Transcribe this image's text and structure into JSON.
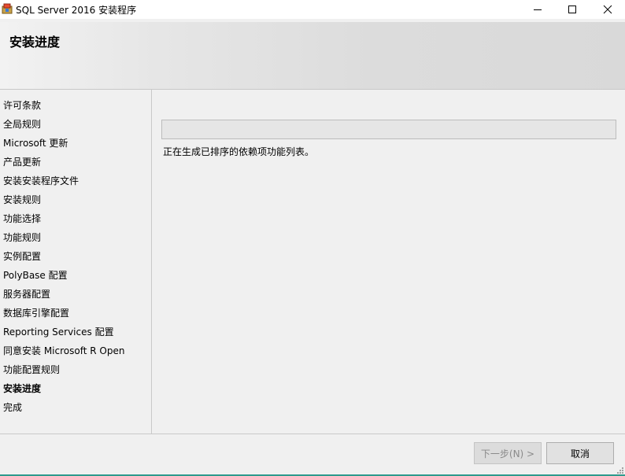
{
  "window": {
    "title": "SQL Server 2016 安装程序",
    "icon": "sql-setup-icon"
  },
  "header": {
    "heading": "安装进度"
  },
  "sidebar": {
    "items": [
      {
        "label": "许可条款",
        "active": false
      },
      {
        "label": "全局规则",
        "active": false
      },
      {
        "label": "Microsoft 更新",
        "active": false
      },
      {
        "label": "产品更新",
        "active": false
      },
      {
        "label": "安装安装程序文件",
        "active": false
      },
      {
        "label": "安装规则",
        "active": false
      },
      {
        "label": "功能选择",
        "active": false
      },
      {
        "label": "功能规则",
        "active": false
      },
      {
        "label": "实例配置",
        "active": false
      },
      {
        "label": "PolyBase 配置",
        "active": false
      },
      {
        "label": "服务器配置",
        "active": false
      },
      {
        "label": "数据库引擎配置",
        "active": false
      },
      {
        "label": "Reporting Services 配置",
        "active": false
      },
      {
        "label": "同意安装 Microsoft R Open",
        "active": false
      },
      {
        "label": "功能配置规则",
        "active": false
      },
      {
        "label": "安装进度",
        "active": true
      },
      {
        "label": "完成",
        "active": false
      }
    ]
  },
  "main": {
    "progress_fraction": 0,
    "status": "正在生成已排序的依赖项功能列表。"
  },
  "footer": {
    "next_label": "下一步(N) >",
    "cancel_label": "取消"
  },
  "colors": {
    "header_gradient_start": "#f2f2f2",
    "header_gradient_end": "#d9d9d9",
    "window_bg": "#f0f0f0",
    "accent": "#2e9a8c"
  }
}
